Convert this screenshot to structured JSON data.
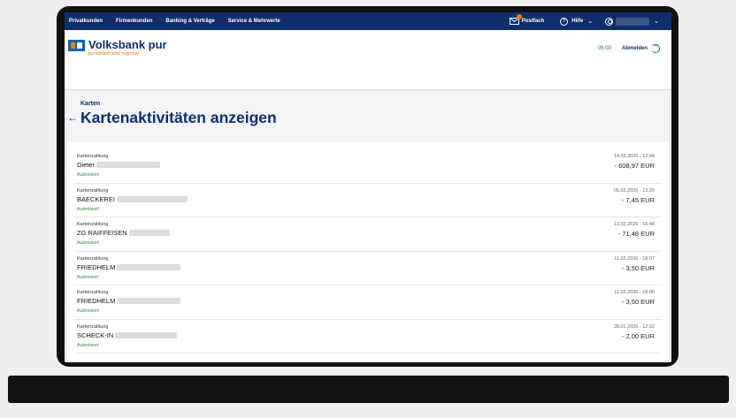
{
  "topnav": {
    "items": [
      "Privatkunden",
      "Firmenkunden",
      "Banking & Verträge",
      "Service & Mehrwerte"
    ],
    "postfach": "Postfach",
    "hilfe": "Hilfe"
  },
  "header": {
    "brand": "Volksbank pur",
    "tagline": "persönlich und regional",
    "session_timer": "05:00",
    "logout_label": "Abmelden"
  },
  "page": {
    "breadcrumb": "Karten",
    "back_icon": "←",
    "title": "Kartenaktivitäten anzeigen"
  },
  "transactions": [
    {
      "type": "Kartenzahlung",
      "merchant": "Dieter",
      "status": "Autorisiert",
      "datetime": "14.03.2026 - 12:04",
      "amount": "- 608,97 EUR"
    },
    {
      "type": "Kartenzahlung",
      "merchant": "BAECKEREI",
      "status": "Autorisiert",
      "datetime": "05.03.2026 - 13:29",
      "amount": "- 7,45 EUR"
    },
    {
      "type": "Kartenzahlung",
      "merchant": "ZG RAIFFEISEN",
      "status": "Autorisiert",
      "datetime": "13.02.2026 - 16:48",
      "amount": "- 71,48 EUR"
    },
    {
      "type": "Kartenzahlung",
      "merchant": "FRIEDHELM",
      "status": "Autorisiert",
      "datetime": "11.02.2026 - 18:07",
      "amount": "- 3,50 EUR"
    },
    {
      "type": "Kartenzahlung",
      "merchant": "FRIEDHELM",
      "status": "Autorisiert",
      "datetime": "11.02.2026 - 18:06",
      "amount": "- 3,50 EUR"
    },
    {
      "type": "Kartenzahlung",
      "merchant": "SCHECK-IN",
      "status": "Autorisiert",
      "datetime": "28.01.2026 - 12:32",
      "amount": "- 2,00 EUR"
    }
  ],
  "colors": {
    "nav_bg": "#0f2f6b",
    "brand_blue": "#0066b3",
    "brand_orange": "#f27a1a",
    "status_green": "#2e8b3d"
  },
  "icons": [
    "mail-icon",
    "help-icon",
    "user-icon",
    "chevron-down-icon",
    "logout-icon",
    "back-arrow-icon"
  ]
}
